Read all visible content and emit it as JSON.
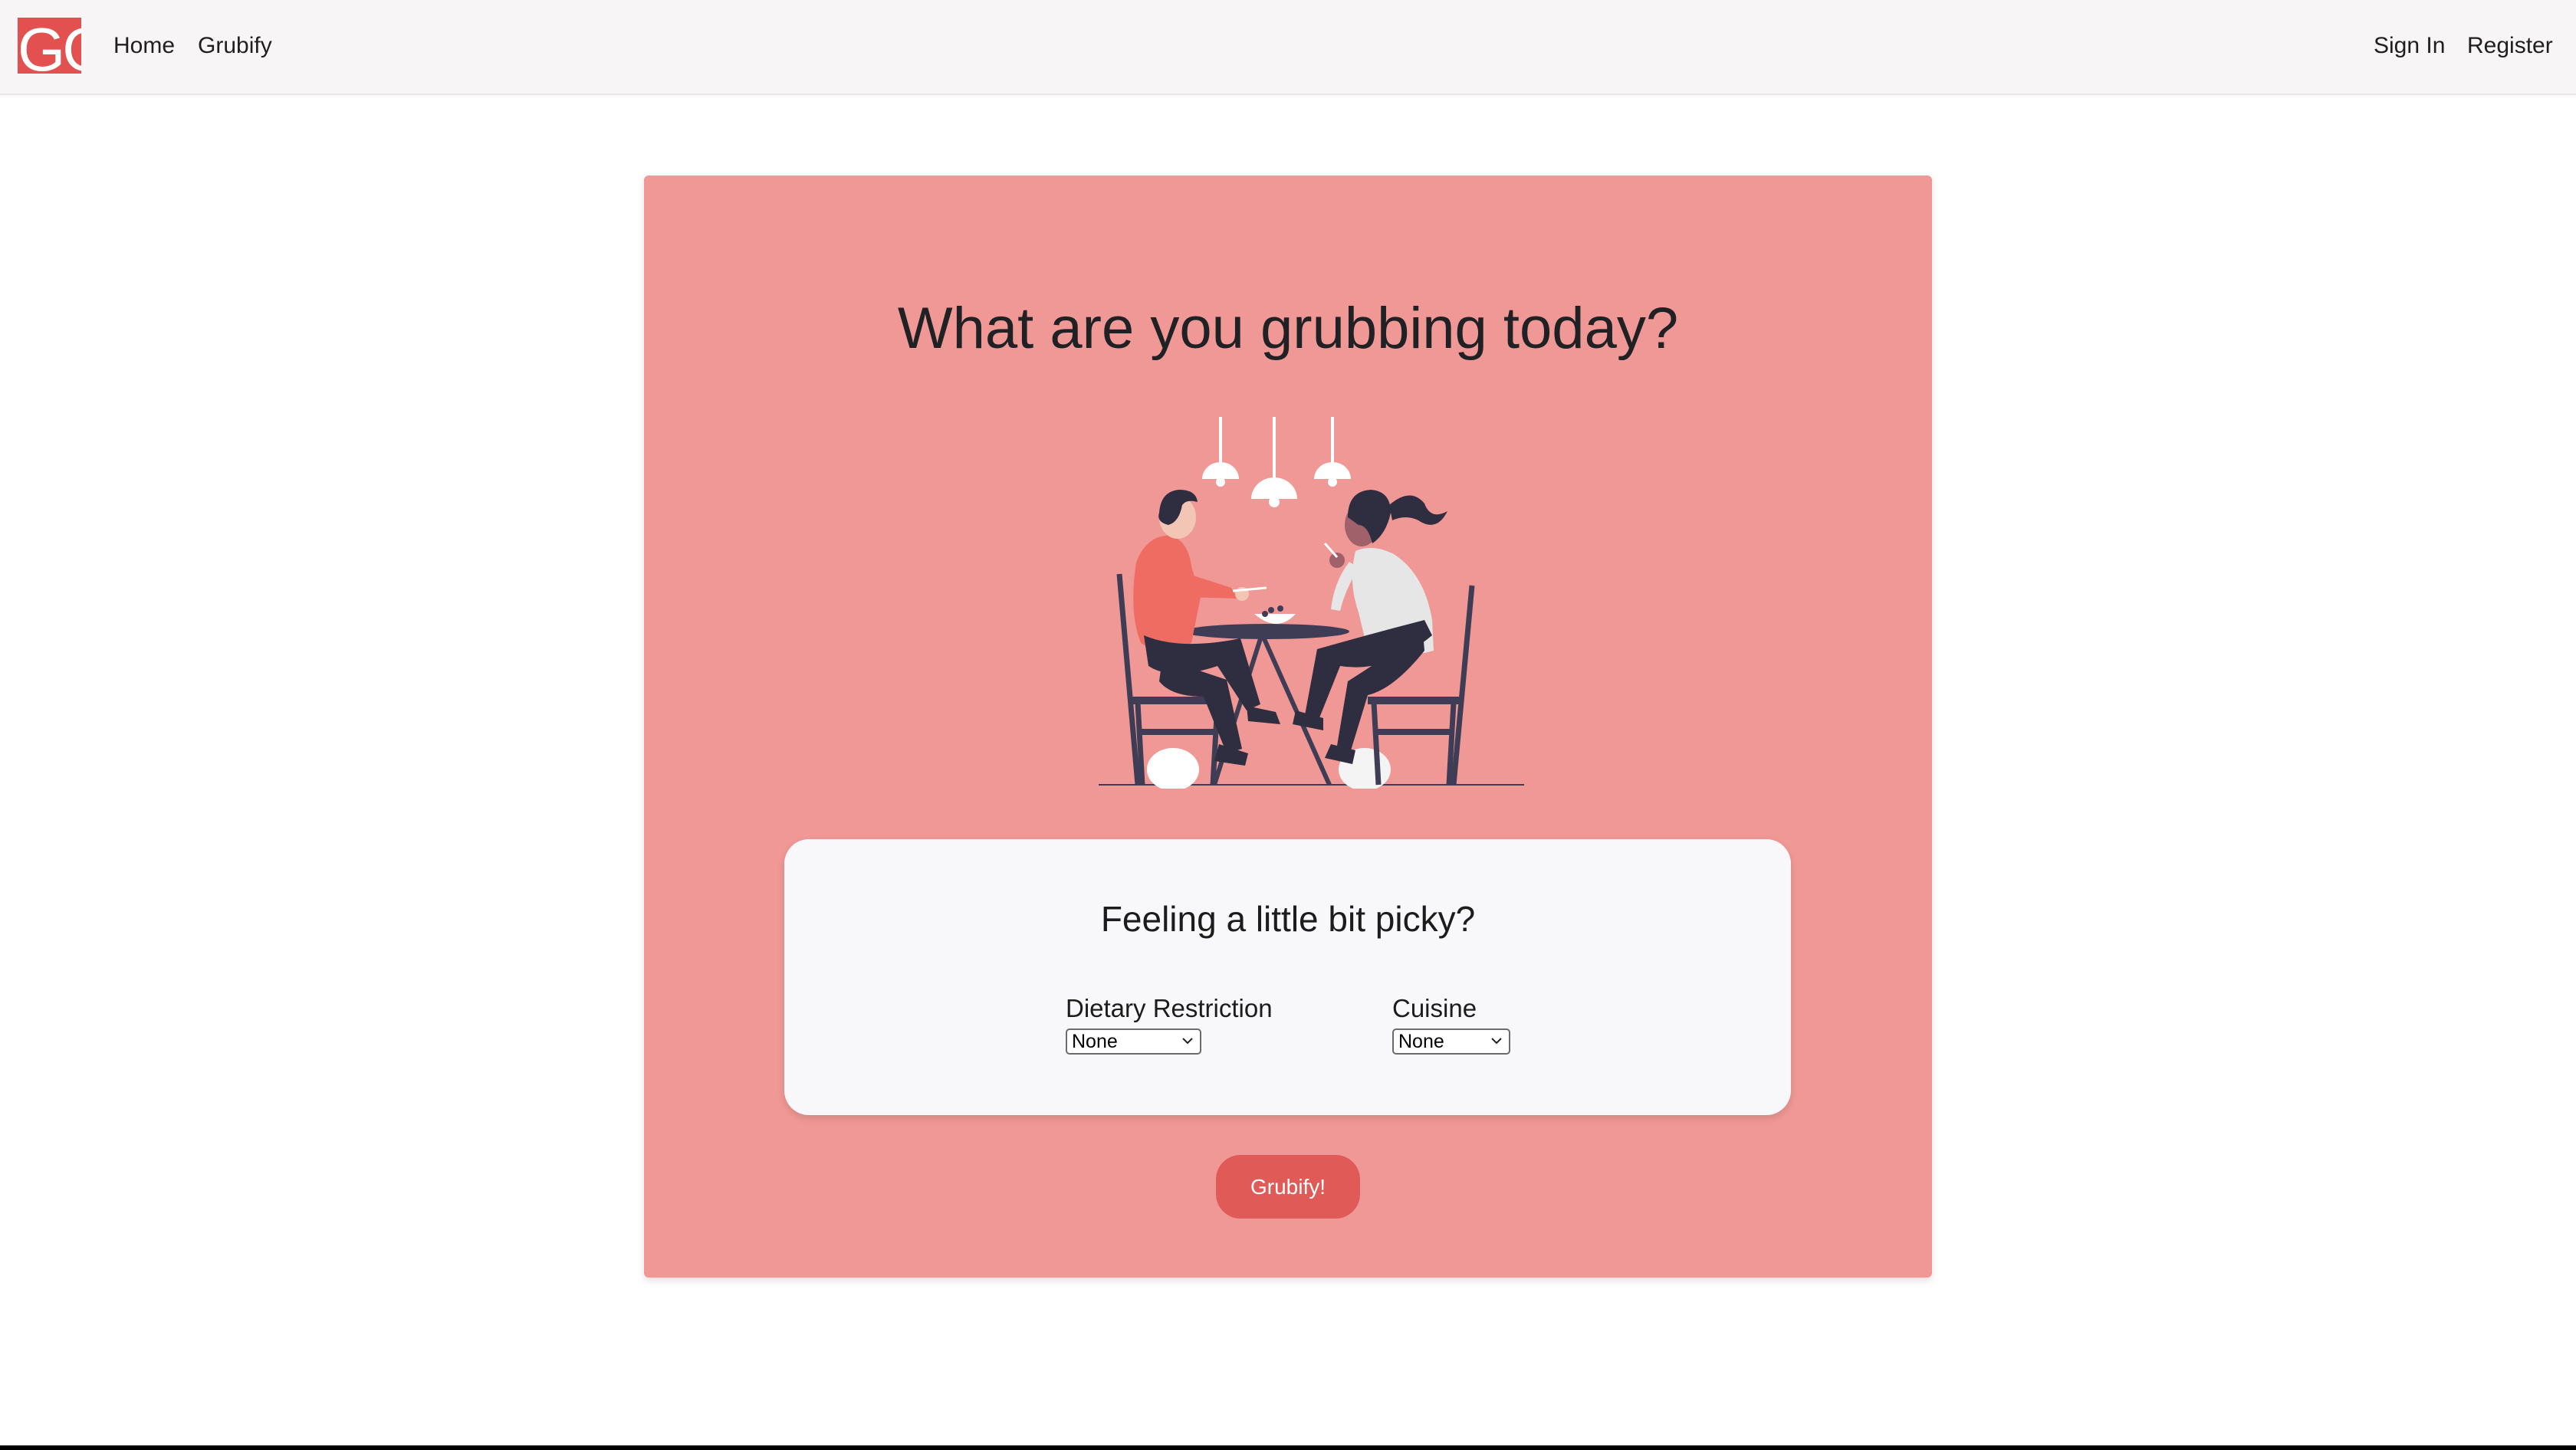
{
  "brand": {
    "logo_text": "GG",
    "logo_color": "#e2514f"
  },
  "nav": {
    "left": [
      {
        "label": "Home"
      },
      {
        "label": "Grubify"
      }
    ],
    "right": [
      {
        "label": "Sign In"
      },
      {
        "label": "Register"
      }
    ]
  },
  "hero": {
    "title": "What are you grubbing today?",
    "background": "#f09895",
    "illustration": "two-people-dining-at-table-illustration"
  },
  "filters": {
    "heading": "Feeling a little bit picky?",
    "dietary": {
      "label": "Dietary Restriction",
      "value": "None"
    },
    "cuisine": {
      "label": "Cuisine",
      "value": "None"
    }
  },
  "action": {
    "label": "Grubify!",
    "color": "#e05a57"
  }
}
